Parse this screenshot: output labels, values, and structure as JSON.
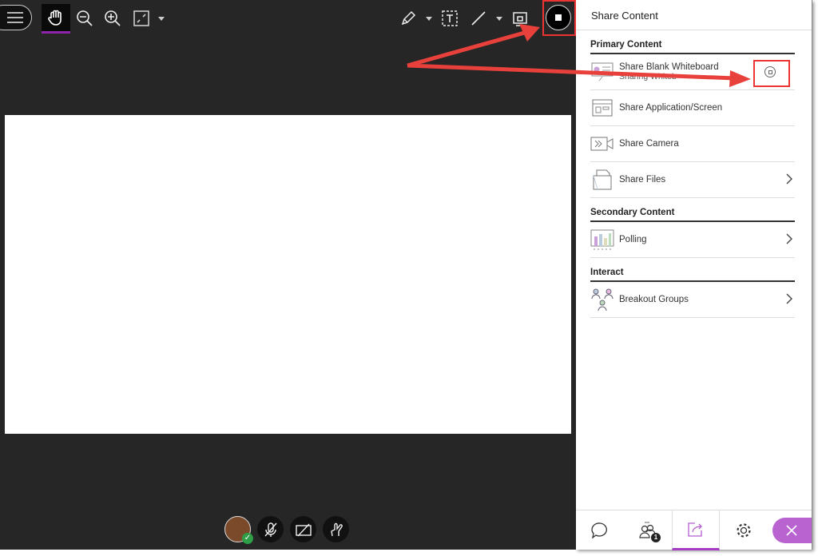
{
  "toolbar": {
    "icons": [
      "menu-icon",
      "hand-icon",
      "zoom-out-icon",
      "zoom-in-icon",
      "fit-icon",
      "pencil-icon",
      "text-icon",
      "line-icon",
      "eraser-icon",
      "stop-sharing-icon"
    ],
    "accent": "#8e24aa"
  },
  "panel": {
    "title": "Share Content",
    "primary_heading": "Primary Content",
    "primary": [
      {
        "label": "Share Blank Whiteboard",
        "sub": "Sharing Whiteb"
      },
      {
        "label": "Share Application/Screen"
      },
      {
        "label": "Share Camera"
      },
      {
        "label": "Share Files"
      }
    ],
    "secondary_heading": "Secondary Content",
    "secondary": [
      {
        "label": "Polling"
      }
    ],
    "interact_heading": "Interact",
    "interact": [
      {
        "label": "Breakout Groups"
      }
    ],
    "participants_count": "1"
  },
  "annotation_color": "#e8403a"
}
